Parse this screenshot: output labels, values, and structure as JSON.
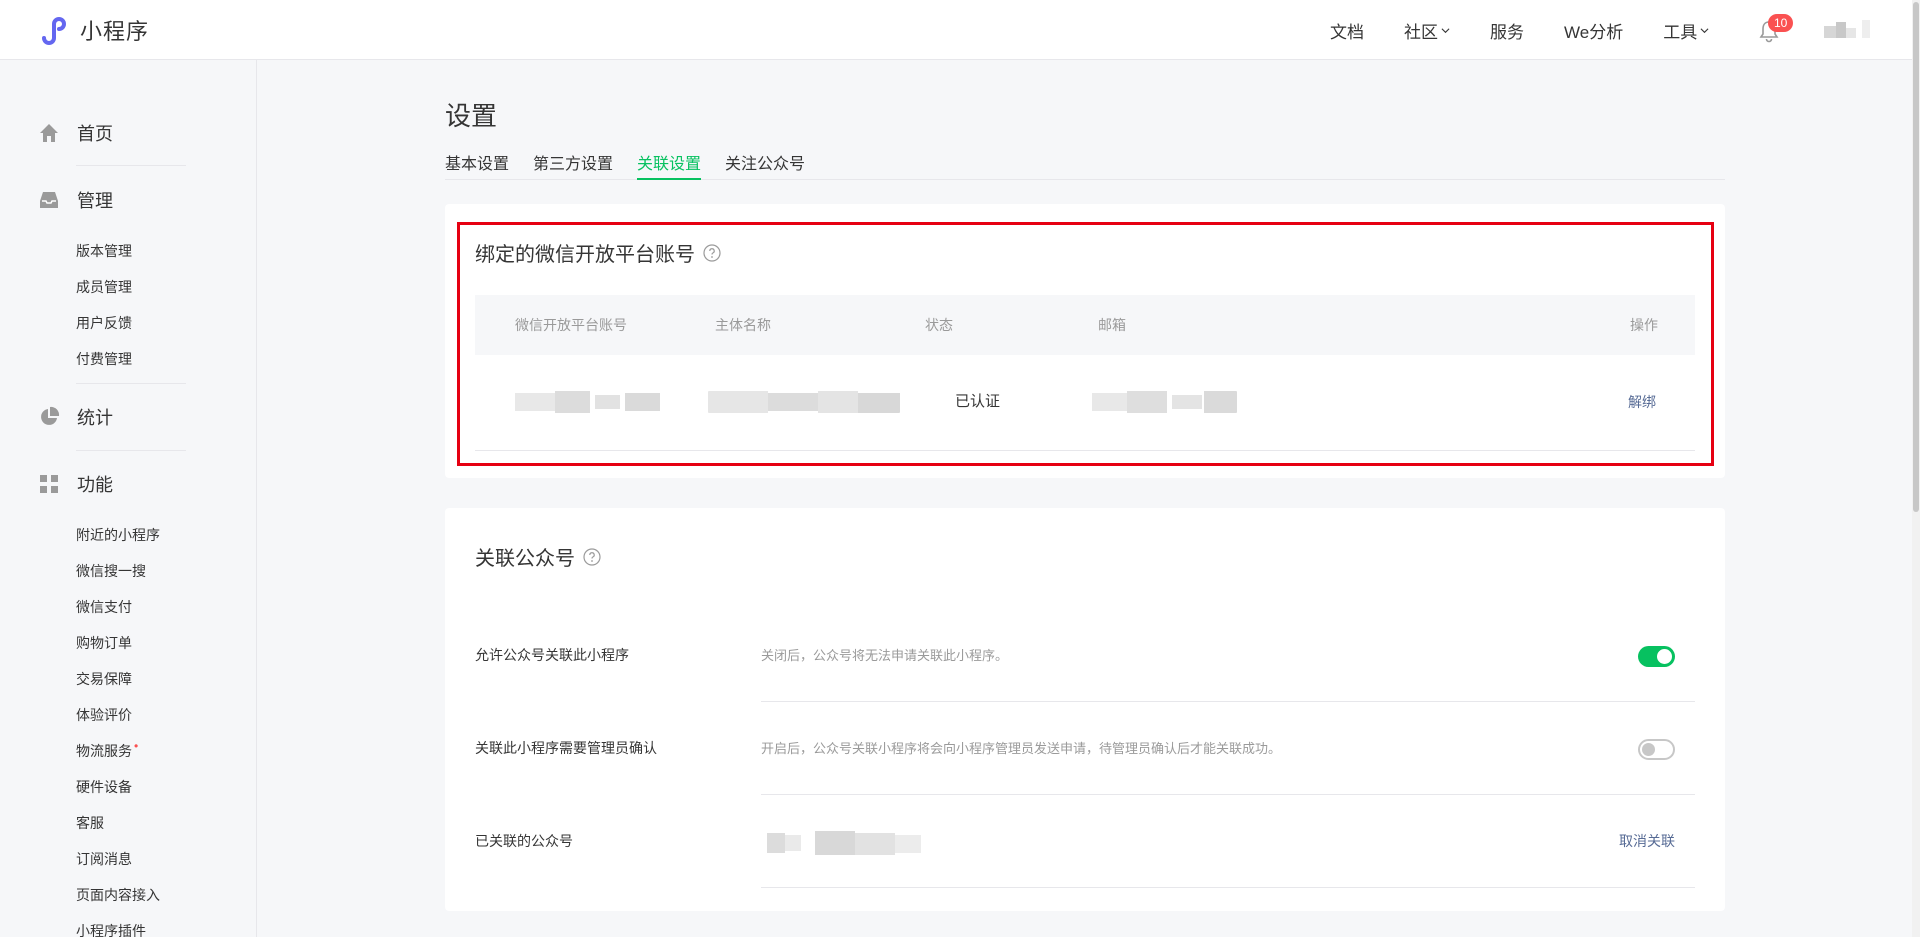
{
  "app": {
    "name": "小程序",
    "brand_color": "#07c160",
    "accent_link": "#576b95"
  },
  "topnav": {
    "items": [
      {
        "label": "文档",
        "has_dropdown": false
      },
      {
        "label": "社区",
        "has_dropdown": true
      },
      {
        "label": "服务",
        "has_dropdown": false
      },
      {
        "label": "We分析",
        "has_dropdown": false
      },
      {
        "label": "工具",
        "has_dropdown": true
      }
    ],
    "notifications": {
      "icon": "bell-icon",
      "count": "10"
    }
  },
  "sidebar": {
    "groups": [
      {
        "label": "首页",
        "icon": "home-icon",
        "items": []
      },
      {
        "label": "管理",
        "icon": "inbox-icon",
        "items": [
          "版本管理",
          "成员管理",
          "用户反馈",
          "付费管理"
        ]
      },
      {
        "label": "统计",
        "icon": "pie-chart-icon",
        "items": []
      },
      {
        "label": "功能",
        "icon": "grid-icon",
        "items": [
          "附近的小程序",
          "微信搜一搜",
          "微信支付",
          "购物订单",
          "交易保障",
          "体验评价",
          "物流服务",
          "硬件设备",
          "客服",
          "订阅消息",
          "页面内容接入",
          "小程序插件"
        ]
      }
    ],
    "badge_dot_item": "物流服务",
    "badge_dot": "•"
  },
  "page": {
    "title": "设置",
    "tabs": [
      {
        "label": "基本设置",
        "active": false
      },
      {
        "label": "第三方设置",
        "active": false
      },
      {
        "label": "关联设置",
        "active": true
      },
      {
        "label": "关注公众号",
        "active": false
      }
    ]
  },
  "open_platform": {
    "title": "绑定的微信开放平台账号",
    "help_icon": "question-circle-icon",
    "columns": [
      "微信开放平台账号",
      "主体名称",
      "状态",
      "邮箱",
      "操作"
    ],
    "row": {
      "account": "",
      "entity": "",
      "status": "已认证",
      "email": "",
      "action": "解绑"
    }
  },
  "linked_official": {
    "title": "关联公众号",
    "help_icon": "question-circle-icon",
    "settings": [
      {
        "label": "允许公众号关联此小程序",
        "desc": "关闭后，公众号将无法申请关联此小程序。",
        "toggle": "on"
      },
      {
        "label": "关联此小程序需要管理员确认",
        "desc": "开启后，公众号关联小程序将会向小程序管理员发送申请，待管理员确认后才能关联成功。",
        "toggle": "off"
      }
    ],
    "linked": {
      "label": "已关联的公众号",
      "name": "",
      "action": "取消关联"
    }
  }
}
